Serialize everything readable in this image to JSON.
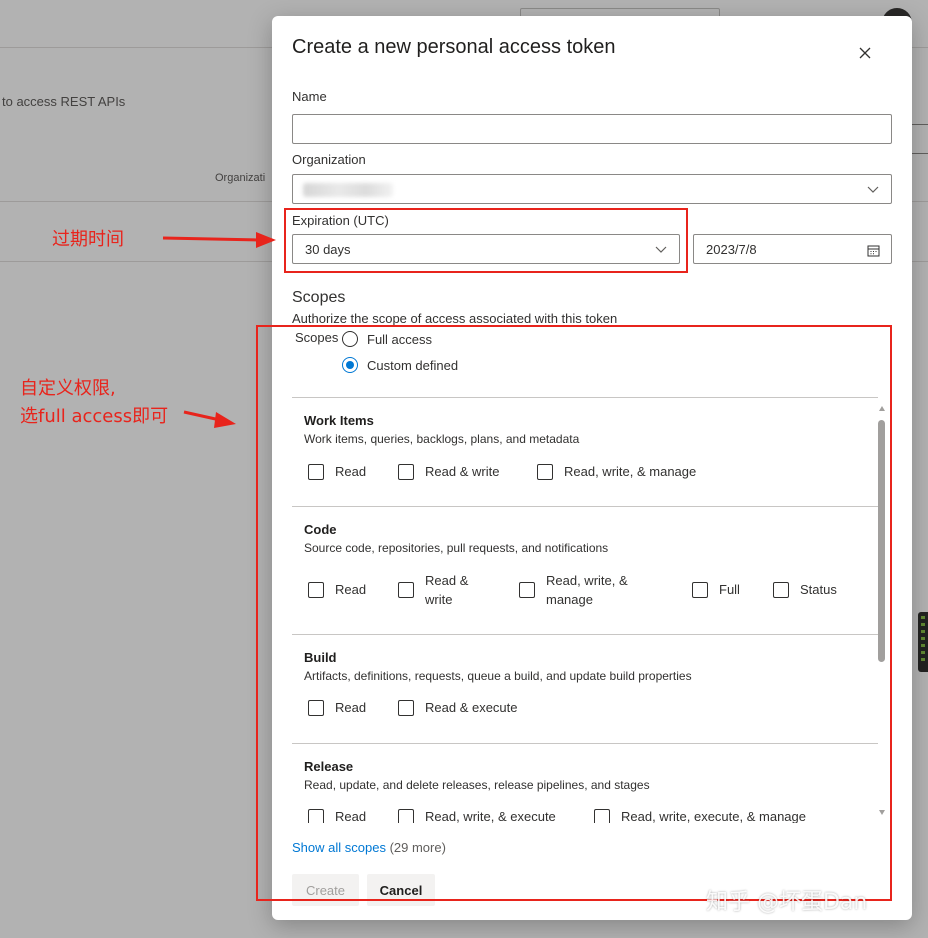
{
  "background": {
    "description_fragment": "to access REST APIs",
    "column_header_fragment": "Organizati"
  },
  "dialog": {
    "title": "Create a new personal access token",
    "name": {
      "label": "Name",
      "value": ""
    },
    "organization": {
      "label": "Organization",
      "value": ""
    },
    "expiration": {
      "label": "Expiration (UTC)",
      "selected": "30 days",
      "date": "2023/7/8"
    },
    "scopes": {
      "heading": "Scopes",
      "subtitle": "Authorize the scope of access associated with this token",
      "group_label": "Scopes",
      "options": [
        {
          "label": "Full access",
          "selected": false
        },
        {
          "label": "Custom defined",
          "selected": true
        }
      ],
      "sections": [
        {
          "title": "Work Items",
          "description": "Work items, queries, backlogs, plans, and metadata",
          "options": [
            "Read",
            "Read & write",
            "Read, write, & manage"
          ]
        },
        {
          "title": "Code",
          "description": "Source code, repositories, pull requests, and notifications",
          "options": [
            "Read",
            "Read &",
            "write",
            "Read, write, &",
            "manage",
            "Full",
            "Status"
          ]
        },
        {
          "title": "Build",
          "description": "Artifacts, definitions, requests, queue a build, and update build properties",
          "options": [
            "Read",
            "Read & execute"
          ]
        },
        {
          "title": "Release",
          "description": "Read, update, and delete releases, release pipelines, and stages",
          "options": [
            "Read",
            "Read, write, & execute",
            "Read, write, execute, & manage"
          ]
        }
      ]
    },
    "show_all": {
      "link": "Show all scopes",
      "more": "(29 more)"
    },
    "buttons": {
      "create": "Create",
      "cancel": "Cancel"
    }
  },
  "annotations": {
    "expiration_note": "过期时间",
    "scope_note_line1": "自定义权限,",
    "scope_note_line2": "选full access即可",
    "color": "#e8241c"
  },
  "watermark": "知乎 @坏蛋Dan",
  "colors": {
    "accent": "#0078d4",
    "annotation": "#e8241c"
  }
}
